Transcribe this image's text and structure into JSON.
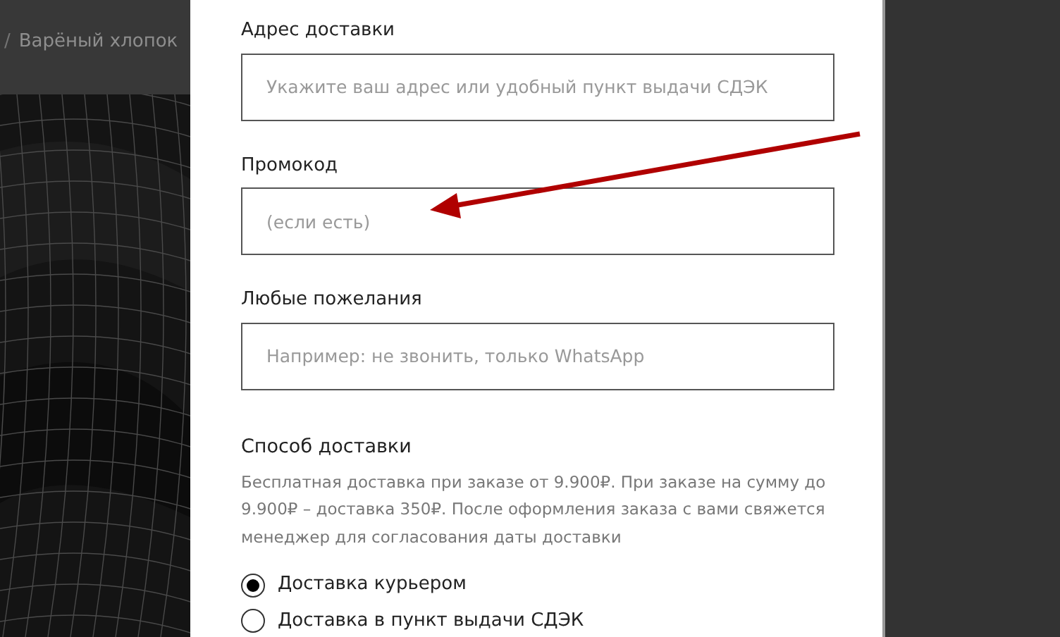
{
  "breadcrumb": [
    {
      "text": "/",
      "kind": "separator"
    },
    {
      "text": "Варёный хлопок",
      "kind": "link"
    }
  ],
  "form": {
    "fields": [
      {
        "label": "Адрес доставки",
        "placeholder": "Укажите ваш адрес или удобный пункт выдачи СДЭК"
      },
      {
        "label": "Промокод",
        "placeholder": "(если есть)"
      },
      {
        "label": "Любые пожелания",
        "placeholder": "Например: не звонить, только WhatsApp"
      }
    ],
    "delivery": {
      "title": "Способ доставки",
      "description": "Бесплатная доставка при заказе от 9.900₽. При заказе на сумму до 9.900₽ – доставка 350₽. После оформления заказа с вами свяжется менеджер для согласования даты доставки",
      "options": [
        {
          "label": "Доставка курьером",
          "selected": true
        },
        {
          "label": "Доставка в пункт выдачи СДЭК",
          "selected": false
        }
      ]
    }
  }
}
